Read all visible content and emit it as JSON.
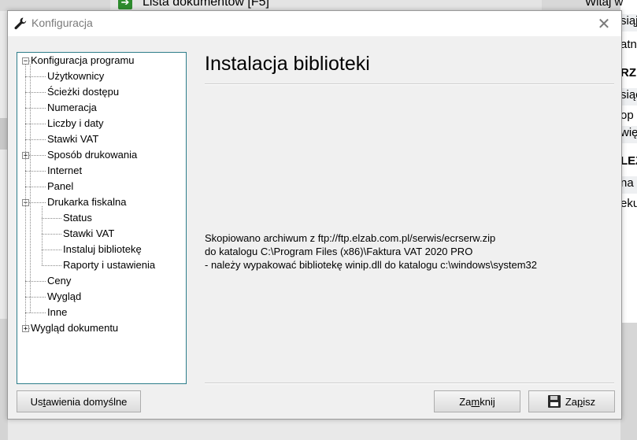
{
  "background": {
    "doc_list_label": "Lista dokumentów [F5]",
    "right_top": "Witaj w",
    "right_rows": [
      {
        "text": "siąj",
        "bold": false,
        "shade": true
      },
      {
        "text": "atn",
        "bold": false,
        "shade": false
      },
      {
        "text": "RZE",
        "bold": true,
        "shade": false
      },
      {
        "text": "siąc",
        "bold": false,
        "shade": true
      },
      {
        "text": "op",
        "bold": false,
        "shade": false
      },
      {
        "text": "wię",
        "bold": false,
        "shade": true
      },
      {
        "text": "LEŻ",
        "bold": true,
        "shade": false
      },
      {
        "text": "na r",
        "bold": false,
        "shade": true
      },
      {
        "text": "eku",
        "bold": false,
        "shade": false
      }
    ]
  },
  "dialog": {
    "title": "Konfiguracja",
    "close_symbol": "✕"
  },
  "tree": {
    "items": [
      {
        "label": "Konfiguracja programu",
        "level": 0,
        "expander": "−"
      },
      {
        "label": "Użytkownicy",
        "level": 1,
        "expander": ""
      },
      {
        "label": "Ścieżki dostępu",
        "level": 1,
        "expander": ""
      },
      {
        "label": "Numeracja",
        "level": 1,
        "expander": ""
      },
      {
        "label": "Liczby i daty",
        "level": 1,
        "expander": ""
      },
      {
        "label": "Stawki VAT",
        "level": 1,
        "expander": ""
      },
      {
        "label": "Sposób drukowania",
        "level": 1,
        "expander": "+"
      },
      {
        "label": "Internet",
        "level": 1,
        "expander": ""
      },
      {
        "label": "Panel",
        "level": 1,
        "expander": ""
      },
      {
        "label": "Drukarka fiskalna",
        "level": 1,
        "expander": "−"
      },
      {
        "label": "Status",
        "level": 2,
        "expander": ""
      },
      {
        "label": "Stawki VAT",
        "level": 2,
        "expander": ""
      },
      {
        "label": "Instaluj bibliotekę",
        "level": 2,
        "expander": ""
      },
      {
        "label": "Raporty i ustawienia",
        "level": 2,
        "expander": ""
      },
      {
        "label": "Ceny",
        "level": 1,
        "expander": ""
      },
      {
        "label": "Wygląd",
        "level": 1,
        "expander": ""
      },
      {
        "label": "Inne",
        "level": 1,
        "expander": ""
      },
      {
        "label": "Wygląd dokumentu",
        "level": 0,
        "expander": "+"
      }
    ]
  },
  "content": {
    "heading": "Instalacja biblioteki",
    "message_lines": [
      "Skopiowano archiwum z ftp://ftp.elzab.com.pl/serwis/ecrserw.zip",
      "do katalogu C:\\Program Files (x86)\\Faktura VAT 2020 PRO",
      "- należy wypakować bibliotekę winip.dll do katalogu c:\\windows\\system32"
    ]
  },
  "buttons": {
    "defaults": {
      "pre": "Us",
      "mnemonic": "t",
      "post": "awienia domyślne"
    },
    "close": {
      "pre": "Za",
      "mnemonic": "m",
      "post": "knij"
    },
    "save": {
      "pre": "Za",
      "mnemonic": "p",
      "post": "isz",
      "icon": "floppy-disk-icon"
    }
  }
}
